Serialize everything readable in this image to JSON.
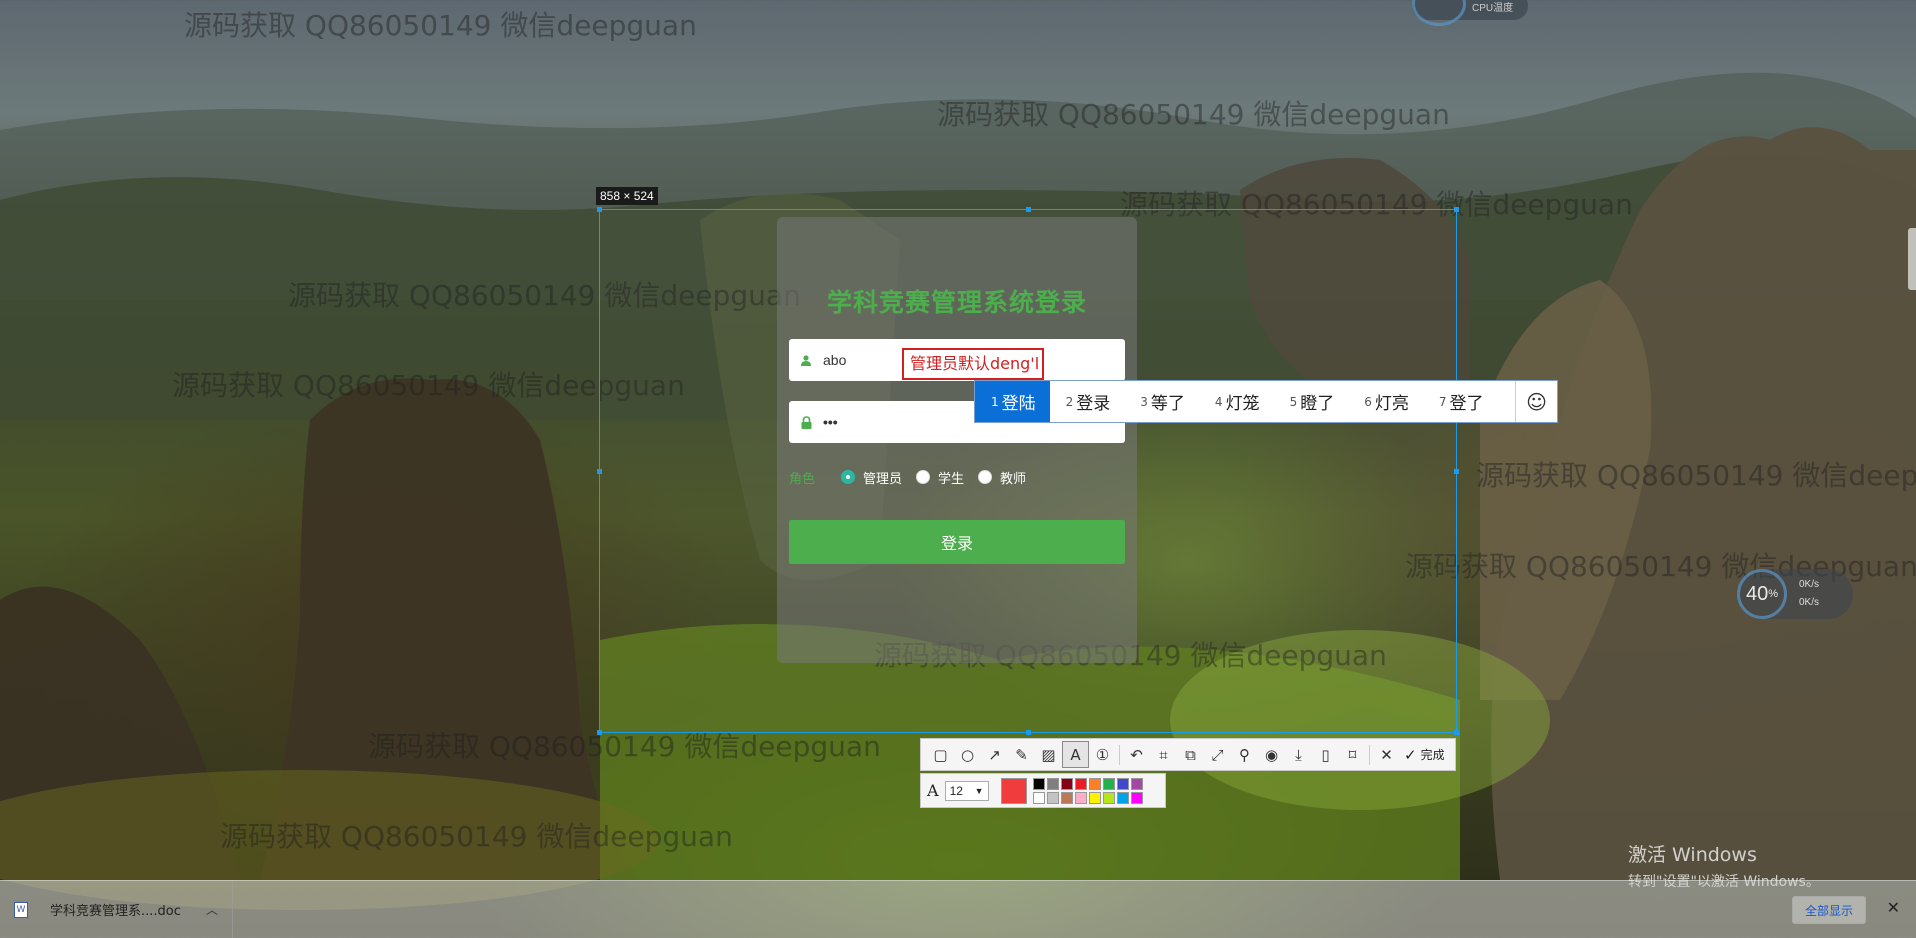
{
  "watermarks": [
    "源码获取 QQ86050149 微信deepguan",
    "源码获取 QQ86050149 微信deepguan",
    "源码获取 QQ86050149 微信deepguan",
    "源码获取 QQ86050149 微信deepguan",
    "源码获取 QQ86050149 微信deepguan",
    "源码获取 QQ86050149 微信deepguan",
    "源码获取 QQ86050149 微信deepguan",
    "源码获取 QQ86050149 微信deepguan",
    "源码获取 QQ86050149 微信deepguan",
    "源码获取 QQ86050149 微信deepguan"
  ],
  "screenshot_tool": {
    "size_label": "858 × 524",
    "selection_color": "#1e9be8"
  },
  "login": {
    "title": "学科竞赛管理系统登录",
    "username_value": "abo",
    "password_value": "•••",
    "annotation_text": "管理员默认deng'l",
    "role_label": "角色",
    "roles": [
      {
        "label": "管理员",
        "checked": true
      },
      {
        "label": "学生",
        "checked": false
      },
      {
        "label": "教师",
        "checked": false
      }
    ],
    "submit_label": "登录",
    "accent_color": "#4cae4c"
  },
  "ime": {
    "candidates": [
      {
        "num": "1",
        "text": "登陆",
        "selected": true
      },
      {
        "num": "2",
        "text": "登录",
        "selected": false
      },
      {
        "num": "3",
        "text": "等了",
        "selected": false
      },
      {
        "num": "4",
        "text": "灯笼",
        "selected": false
      },
      {
        "num": "5",
        "text": "瞪了",
        "selected": false
      },
      {
        "num": "6",
        "text": "灯亮",
        "selected": false
      },
      {
        "num": "7",
        "text": "登了",
        "selected": false
      }
    ],
    "emoji_icon": "smiley-icon"
  },
  "toolbar": {
    "tools": [
      {
        "name": "rectangle-tool",
        "glyph": "▢"
      },
      {
        "name": "ellipse-tool",
        "glyph": "○"
      },
      {
        "name": "arrow-tool",
        "glyph": "↗"
      },
      {
        "name": "pen-tool",
        "glyph": "✎"
      },
      {
        "name": "mosaic-tool",
        "glyph": "▨"
      },
      {
        "name": "text-tool",
        "glyph": "A",
        "active": true
      },
      {
        "name": "number-tool",
        "glyph": "①"
      },
      {
        "name": "undo-tool",
        "glyph": "↶"
      },
      {
        "name": "ocr-tool",
        "glyph": "⌗"
      },
      {
        "name": "copy-image-tool",
        "glyph": "⧉"
      },
      {
        "name": "scroll-capture-tool",
        "glyph": "⤢"
      },
      {
        "name": "pin-tool",
        "glyph": "⚲"
      },
      {
        "name": "record-tool",
        "glyph": "◉"
      },
      {
        "name": "download-tool",
        "glyph": "⤓"
      },
      {
        "name": "phone-tool",
        "glyph": "▯"
      },
      {
        "name": "bookmark-tool",
        "glyph": "⌑"
      }
    ],
    "close_glyph": "✕",
    "done_glyph": "✓",
    "done_label": "完成"
  },
  "text_options": {
    "font_icon": "A",
    "font_size": "12",
    "current_color": "#f03c3c",
    "palette": [
      "#000000",
      "#7f7f7f",
      "#880015",
      "#ed1c24",
      "#ff7f27",
      "#22b14c",
      "#3f48cc",
      "#a349a4",
      "#ffffff",
      "#c3c3c3",
      "#b97a57",
      "#ffaec9",
      "#fff200",
      "#b5e61d",
      "#00a2e8",
      "#ff00ff"
    ]
  },
  "download_bar": {
    "filename": "学科竞赛管理系....doc",
    "show_all_label": "全部显示",
    "close_glyph": "✕"
  },
  "windows_activation": {
    "line1": "激活 Windows",
    "line2": "转到\"设置\"以激活 Windows。"
  },
  "speed_widget": {
    "percent": "40",
    "unit": "%",
    "up": "0K/s",
    "down": "0K/s"
  },
  "cpu_widget": {
    "label": "CPU温度"
  }
}
